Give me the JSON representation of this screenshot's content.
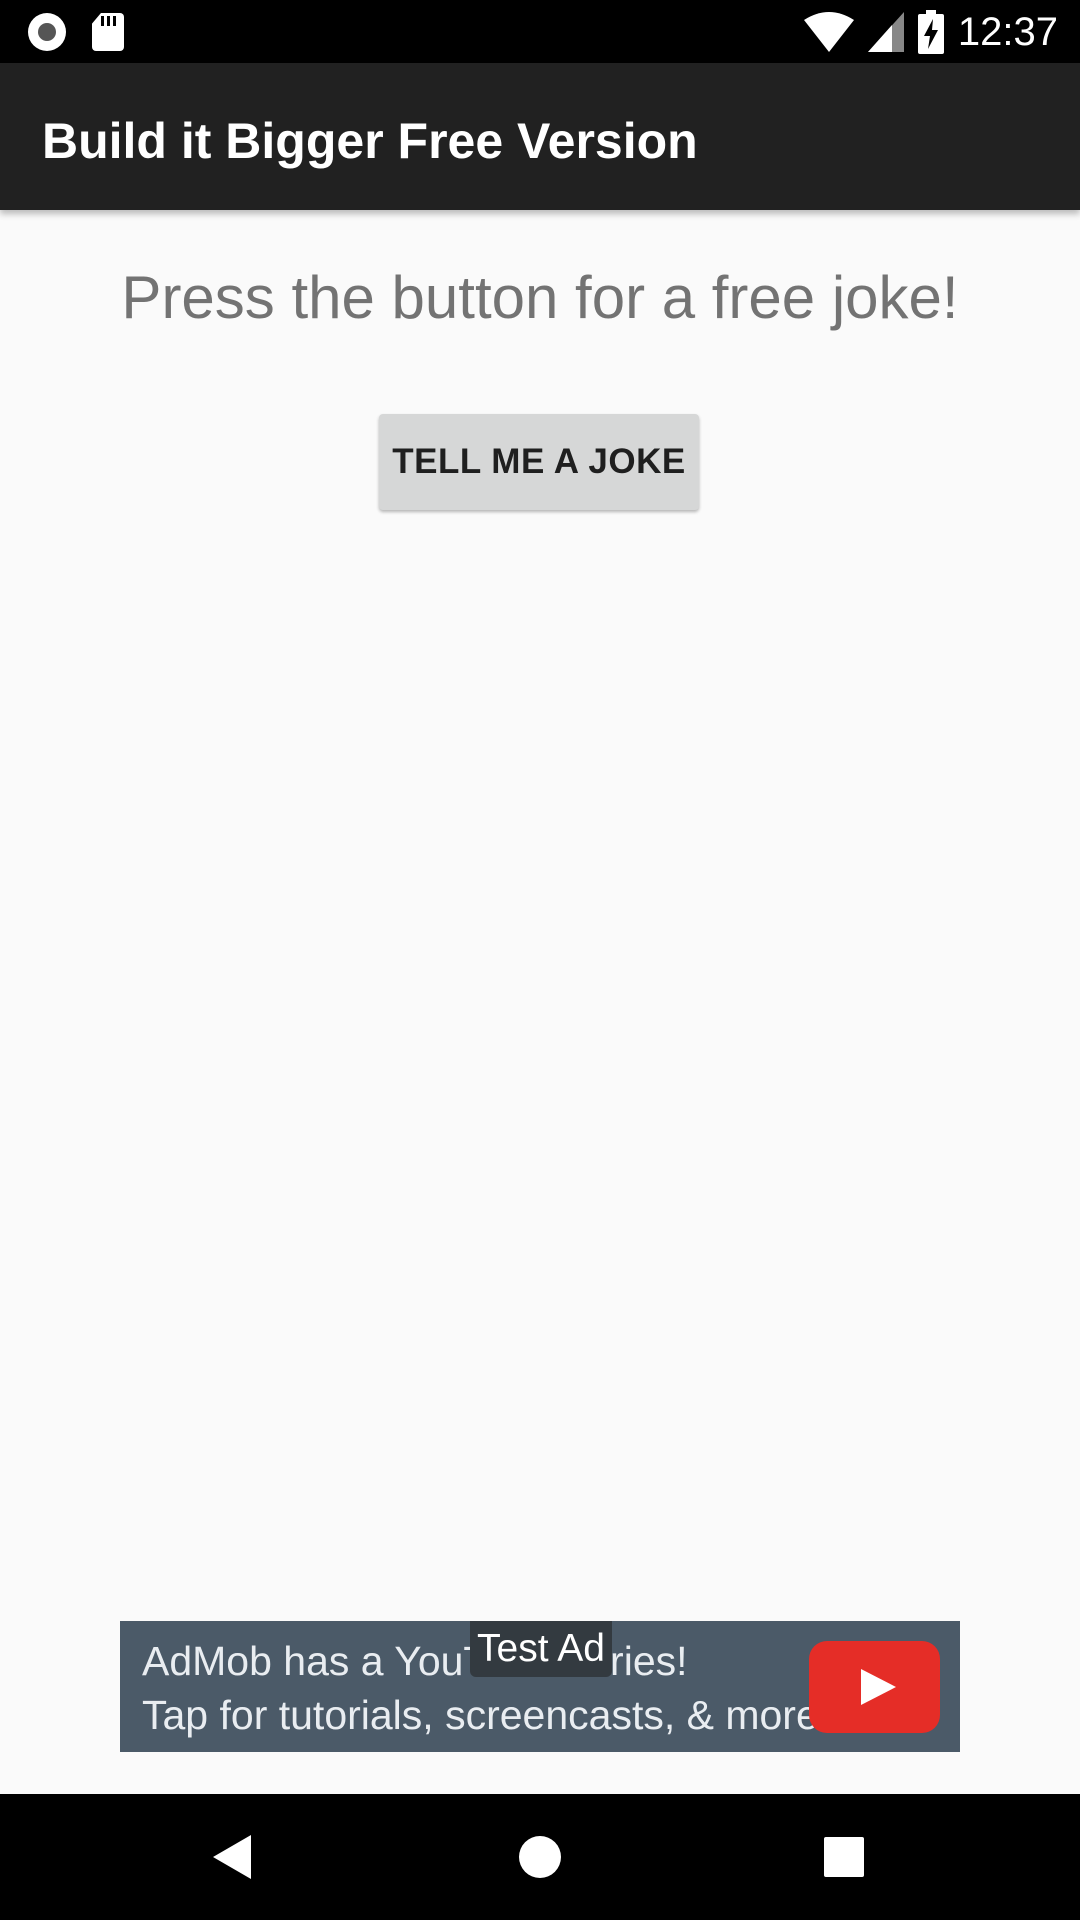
{
  "status_bar": {
    "time": "12:37",
    "icons": [
      "screen-record-icon",
      "sd-card-icon",
      "wifi-icon",
      "cell-signal-icon",
      "battery-charging-icon"
    ]
  },
  "app_bar": {
    "title": "Build it Bigger Free Version"
  },
  "main": {
    "prompt": "Press the button for a free joke!",
    "joke_button_label": "TELL ME A JOKE"
  },
  "ad": {
    "badge": "Test Ad",
    "line1": "AdMob has a YouTube series!",
    "line2": "Tap for tutorials, screencasts, & more.",
    "icon": "youtube-play-icon"
  },
  "nav_bar": {
    "icons": [
      "back-icon",
      "home-icon",
      "recents-icon"
    ]
  },
  "colors": {
    "app_bar": "#212121",
    "background": "#fafafa",
    "button": "#d6d7d7",
    "ad_background": "#4b5a68",
    "youtube_red": "#e52d27"
  }
}
